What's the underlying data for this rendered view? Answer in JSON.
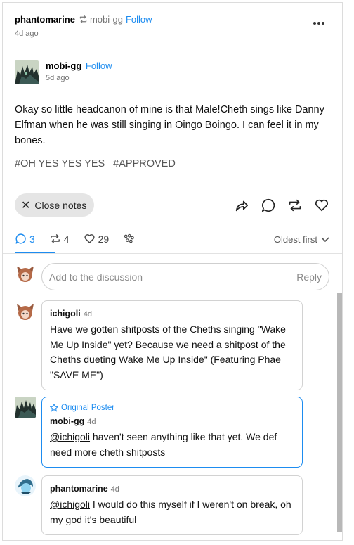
{
  "header": {
    "username": "phantomarine",
    "reblogged_from": "mobi-gg",
    "follow_label": "Follow",
    "time": "4d ago"
  },
  "post": {
    "author": "mobi-gg",
    "follow_label": "Follow",
    "time": "5d ago",
    "text": "Okay so little headcanon of mine is that Male!Cheth sings like Danny Elfman when he was still singing in Oingo Boingo. I can feel it in my bones.",
    "tags": [
      "#OH YES YES YES",
      "#APPROVED"
    ]
  },
  "actions": {
    "close_notes_label": "Close notes",
    "icons": [
      "share-icon",
      "comment-icon",
      "reblog-icon",
      "like-icon"
    ]
  },
  "notes_tabs": {
    "replies": "3",
    "reblogs": "4",
    "likes": "29",
    "sort_label": "Oldest first"
  },
  "composer": {
    "placeholder": "Add to the discussion",
    "reply_label": "Reply"
  },
  "comments": [
    {
      "name": "ichigoli",
      "time": "4d",
      "text": "Have we gotten shitposts of the Cheths singing \"Wake Me Up Inside\" yet? Because we need a shitpost of the Cheths dueting Wake Me Up Inside\" (Featuring Phae \"SAVE ME\")"
    },
    {
      "badge": "Original Poster",
      "name": "mobi-gg",
      "time": "4d",
      "mention": "@ichigoli",
      "text": " haven't seen anything like that yet. We def need more cheth shitposts"
    },
    {
      "name": "phantomarine",
      "time": "4d",
      "mention": "@ichigoli",
      "text": " I would do this myself if I weren't on break, oh my god it's beautiful"
    }
  ],
  "colors": {
    "accent": "#1d8cf0",
    "border": "#d2d2d2"
  }
}
